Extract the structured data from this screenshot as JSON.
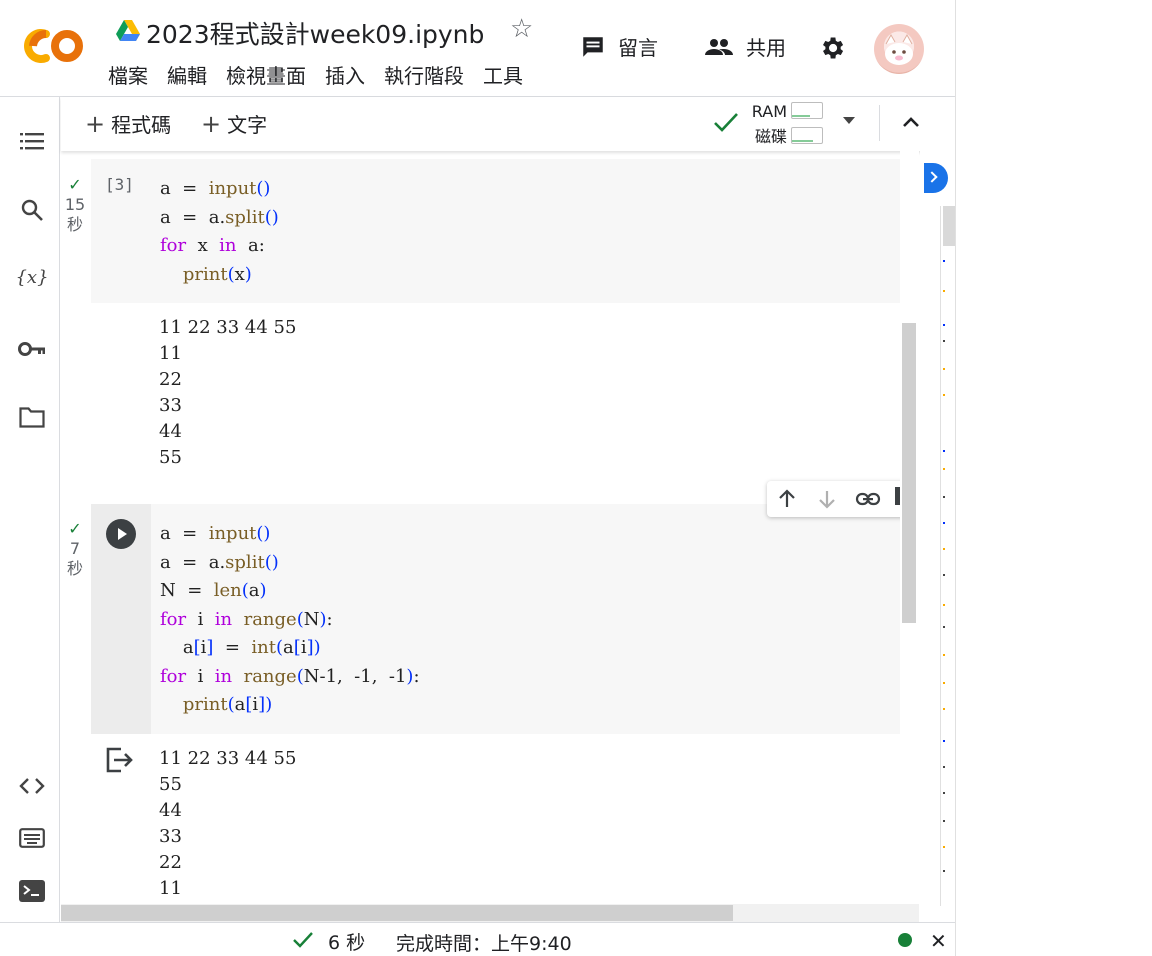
{
  "header": {
    "title": "2023程式設計week09.ipynb",
    "menu": [
      "檔案",
      "編輯",
      "檢視畫面",
      "插入",
      "執行階段",
      "工具"
    ],
    "comment_label": "留言",
    "share_label": "共用"
  },
  "toolbar": {
    "add_code": "程式碼",
    "add_text": "文字",
    "ram_label": "RAM",
    "disk_label": "磁碟"
  },
  "cells": [
    {
      "exec_count": "[3]",
      "status_time": "15",
      "status_unit": "秒",
      "output": [
        "11 22 33 44 55",
        "11",
        "22",
        "33",
        "44",
        "55"
      ]
    },
    {
      "status_time": "7",
      "status_unit": "秒",
      "output": [
        "11 22 33 44 55",
        "55",
        "44",
        "33",
        "22",
        "11"
      ]
    }
  ],
  "statusbar": {
    "elapsed": "6 秒",
    "completed": "完成時間：上午9:40"
  },
  "colors": {
    "keyword": "#af00db",
    "function": "#795e26",
    "bracket": "#0431fa",
    "success": "#188038",
    "accent": "#1a73e8"
  }
}
